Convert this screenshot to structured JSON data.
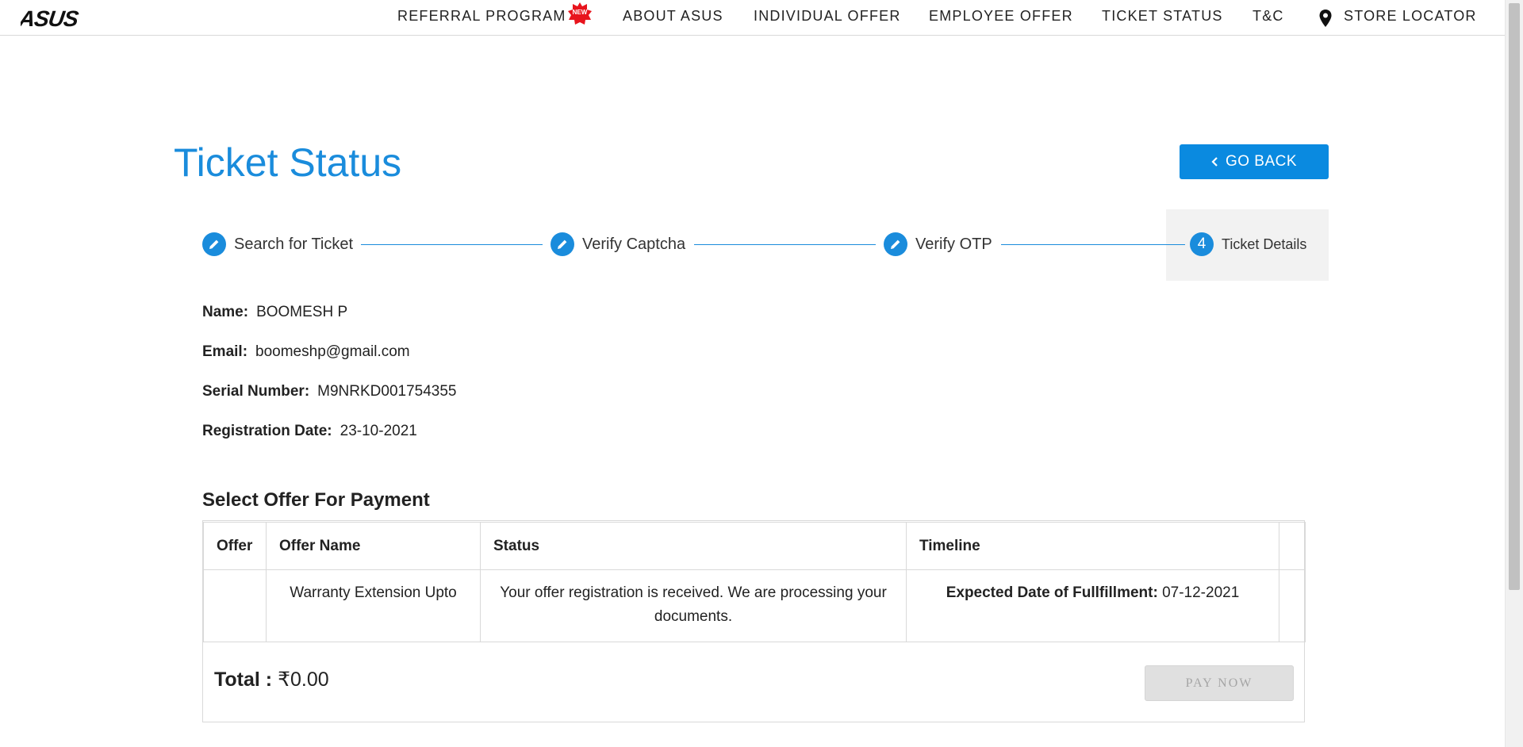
{
  "header": {
    "logo_text": "ASUS",
    "nav": [
      {
        "label": "REFERRAL PROGRAM",
        "badge": "NEW"
      },
      {
        "label": "ABOUT ASUS"
      },
      {
        "label": "INDIVIDUAL OFFER"
      },
      {
        "label": "EMPLOYEE OFFER"
      },
      {
        "label": "TICKET STATUS"
      },
      {
        "label": "T&C"
      },
      {
        "label": "STORE LOCATOR",
        "icon": "location-pin-icon"
      }
    ]
  },
  "page": {
    "title": "Ticket Status",
    "go_back_label": "GO BACK"
  },
  "steps": [
    {
      "label": "Search for Ticket",
      "icon": "pencil-icon",
      "state": "done"
    },
    {
      "label": "Verify Captcha",
      "icon": "pencil-icon",
      "state": "done"
    },
    {
      "label": "Verify OTP",
      "icon": "pencil-icon",
      "state": "done"
    },
    {
      "label": "Ticket Details",
      "number": "4",
      "state": "active"
    }
  ],
  "details": {
    "name_label": "Name:",
    "name_value": "BOOMESH P",
    "email_label": "Email:",
    "email_value": "boomeshp@gmail.com",
    "serial_label": "Serial Number:",
    "serial_value": "M9NRKD001754355",
    "regdate_label": "Registration Date:",
    "regdate_value": "23-10-2021"
  },
  "offers": {
    "section_title": "Select Offer For Payment",
    "columns": [
      "Offer",
      "Offer Name",
      "Status",
      "Timeline"
    ],
    "rows": [
      {
        "offer": "",
        "offer_name": "Warranty Extension Upto",
        "status": "Your offer registration is received. We are processing your documents.",
        "timeline_label": "Expected Date of Fullfillment:",
        "timeline_value": "07-12-2021"
      }
    ],
    "total_label": "Total :",
    "total_value": "₹0.00",
    "pay_now_label": "PAY NOW"
  },
  "colors": {
    "accent": "#1a8cdc",
    "button": "#0a8ae0",
    "disabled_button": "#e0e0e0",
    "new_badge": "#e8141d"
  }
}
